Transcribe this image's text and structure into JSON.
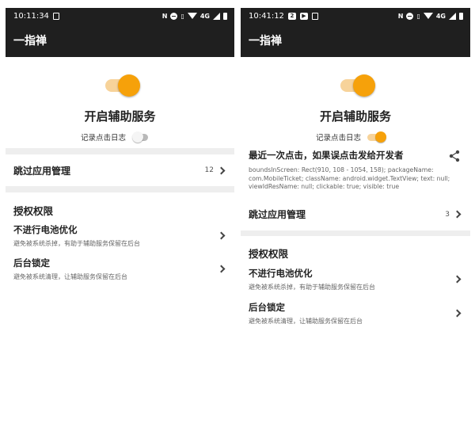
{
  "left": {
    "status_time": "10:11:34",
    "signal_text": "4G",
    "app_title": "一指禅",
    "service_label": "开启辅助服务",
    "log_label": "记录点击日志",
    "log_enabled": false,
    "skip_label": "跳过应用管理",
    "skip_count": "12",
    "perm_title": "授权权限",
    "battery_title": "不进行电池优化",
    "battery_desc": "避免被系统杀掉，有助于辅助服务保留在后台",
    "lock_title": "后台锁定",
    "lock_desc": "避免被系统清理，让辅助服务保留在后台"
  },
  "right": {
    "status_time": "10:41:12",
    "signal_text": "4G",
    "app_title": "一指禅",
    "service_label": "开启辅助服务",
    "log_label": "记录点击日志",
    "log_enabled": true,
    "last_click_title": "最近一次点击，如果误点击发给开发者",
    "last_click_detail": "boundsInScreen: Rect(910, 108 - 1054, 158); packageName: com.MobileTicket; className: android.widget.TextView; text: null; viewIdResName: null; clickable: true; visible: true",
    "skip_label": "跳过应用管理",
    "skip_count": "3",
    "perm_title": "授权权限",
    "battery_title": "不进行电池优化",
    "battery_desc": "避免被系统杀掉，有助于辅助服务保留在后台",
    "lock_title": "后台锁定",
    "lock_desc": "避免被系统清理，让辅助服务保留在后台"
  },
  "colors": {
    "accent": "#f6a10a",
    "accent_track": "#f7d39a",
    "bar": "#1f1f1f",
    "background": "#eeeeee"
  },
  "icons": [
    "nfc-icon",
    "dnd-icon",
    "vibrate-icon",
    "wifi-icon",
    "signal-icon",
    "battery-icon",
    "share-icon",
    "chevron-right-icon"
  ]
}
